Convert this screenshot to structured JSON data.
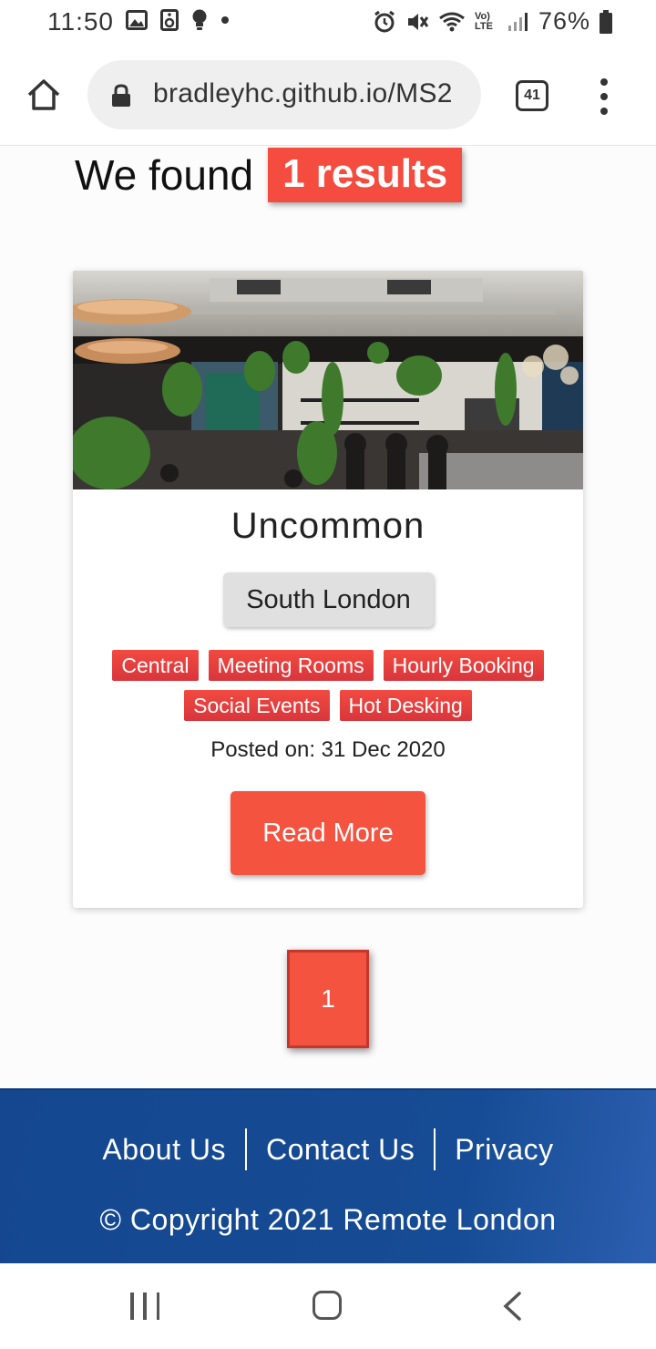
{
  "status_bar": {
    "time": "11:50",
    "battery": "76%",
    "left_icons": [
      "gallery-icon",
      "voicemail-icon",
      "bulb-icon",
      "dot-icon"
    ],
    "right_icons": [
      "alarm-icon",
      "mute-icon",
      "wifi-icon",
      "volte-icon",
      "signal-icon",
      "battery-icon"
    ],
    "volte_label": "Vo) LTE"
  },
  "browser": {
    "url": "bradleyhc.github.io/MS2",
    "tab_count": "41"
  },
  "results": {
    "prefix": "We found",
    "badge": "1 results"
  },
  "card": {
    "title": "Uncommon",
    "area": "South London",
    "tags_row1": [
      "Central",
      "Meeting Rooms",
      "Hourly Booking"
    ],
    "tags_row2": [
      "Social Events",
      "Hot Desking"
    ],
    "posted": "Posted on: 31 Dec 2020",
    "button": "Read More"
  },
  "pagination": {
    "current_page": "1"
  },
  "footer": {
    "links": [
      "About Us",
      "Contact Us",
      "Privacy"
    ],
    "copyright": "© Copyright 2021 Remote London"
  },
  "colors": {
    "accent": "#f4533f",
    "tag": "#e8383f",
    "footer": "#154b93"
  }
}
